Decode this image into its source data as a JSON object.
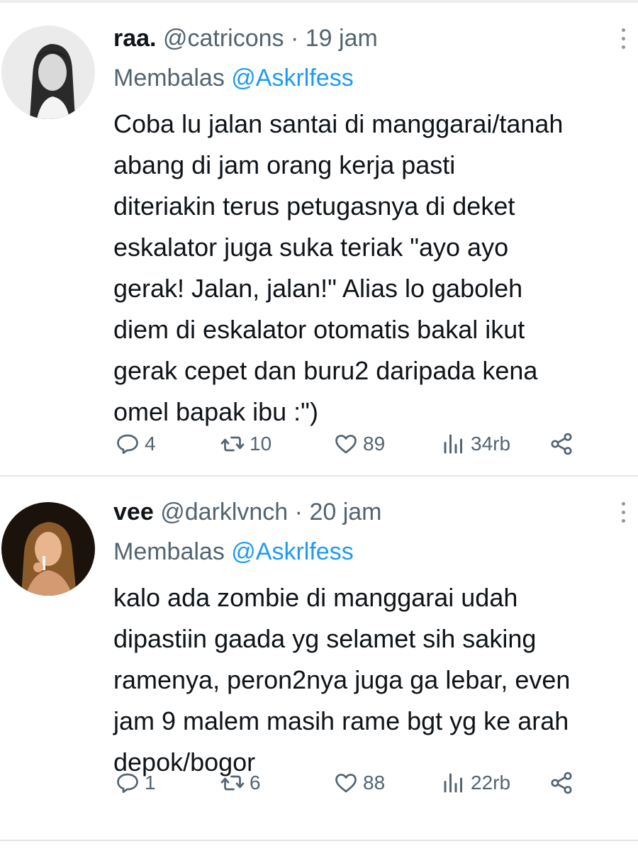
{
  "tweets": [
    {
      "display_name": "raa.",
      "handle": "@catricons",
      "separator": "·",
      "time": "19 jam",
      "reply_prefix": "Membalas",
      "reply_to": "@Askrlfess",
      "text": "Coba lu jalan santai di manggarai/tanah\nabang di jam orang kerja pasti\nditeriakin terus petugasnya di deket\neskalator juga suka teriak \"ayo ayo\ngerak! Jalan, jalan!\" Alias lo gaboleh\ndiem di eskalator otomatis bakal ikut\ngerak cepet dan buru2 daripada kena\nomel bapak ibu :\")",
      "replies": "4",
      "retweets": "10",
      "likes": "89",
      "views": "34rb"
    },
    {
      "display_name": "vee",
      "handle": "@darklvnch",
      "separator": "·",
      "time": "20 jam",
      "reply_prefix": "Membalas",
      "reply_to": "@Askrlfess",
      "text": "kalo ada zombie di manggarai udah\ndipastiin gaada yg selamet sih saking\nramenya, peron2nya juga ga lebar, even\njam 9 malem masih rame bgt yg ke arah\ndepok/bogor",
      "replies": "1",
      "retweets": "6",
      "likes": "88",
      "views": "22rb"
    }
  ],
  "icons": {
    "reply": "reply-icon",
    "retweet": "retweet-icon",
    "like": "heart-icon",
    "views": "views-icon",
    "share": "share-icon",
    "more": "more-icon"
  },
  "colors": {
    "text_primary": "#0f1419",
    "text_secondary": "#536471",
    "mention": "#1d9bf0",
    "divider": "#e6e6e6"
  }
}
